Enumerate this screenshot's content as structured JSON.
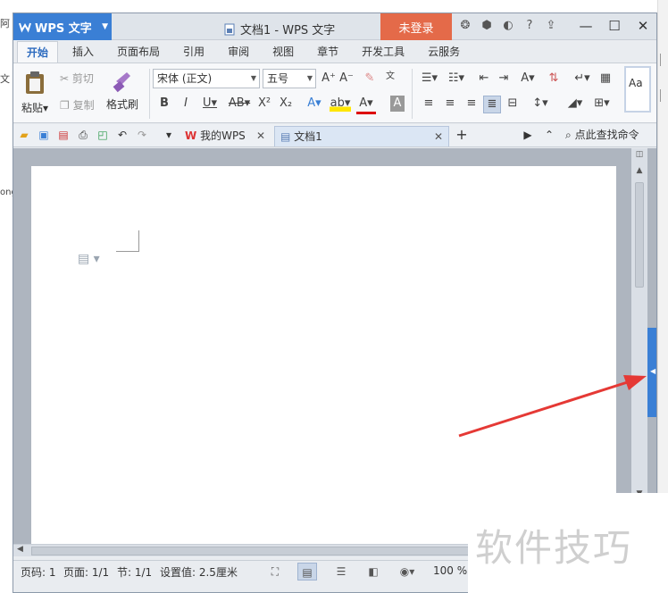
{
  "background": {
    "left_text": [
      "阿",
      "文",
      "ong"
    ]
  },
  "titlebar": {
    "app_name": "WPS 文字",
    "doc_title": "文档1 - WPS 文字",
    "login": "未登录"
  },
  "tabs": [
    "开始",
    "插入",
    "页面布局",
    "引用",
    "审阅",
    "视图",
    "章节",
    "开发工具",
    "云服务"
  ],
  "ribbon": {
    "paste": "粘贴",
    "cut": "剪切",
    "copy": "复制",
    "format_painter": "格式刷",
    "font": "宋体 (正文)",
    "size": "五号",
    "style_preview": "Aa"
  },
  "quickbar": {
    "tab_home": "我的WPS",
    "tab_doc": "文档1",
    "search": "点此查找命令"
  },
  "status": {
    "word_count": "页码: 1",
    "pages": "页面: 1/1",
    "section": "节: 1/1",
    "setting": "设置值: 2.5厘米",
    "zoom": "100 %"
  },
  "watermark": "软件技巧",
  "colors": {
    "accent": "#3a7fd5",
    "login": "#e46a49",
    "arrow": "#e53935"
  }
}
